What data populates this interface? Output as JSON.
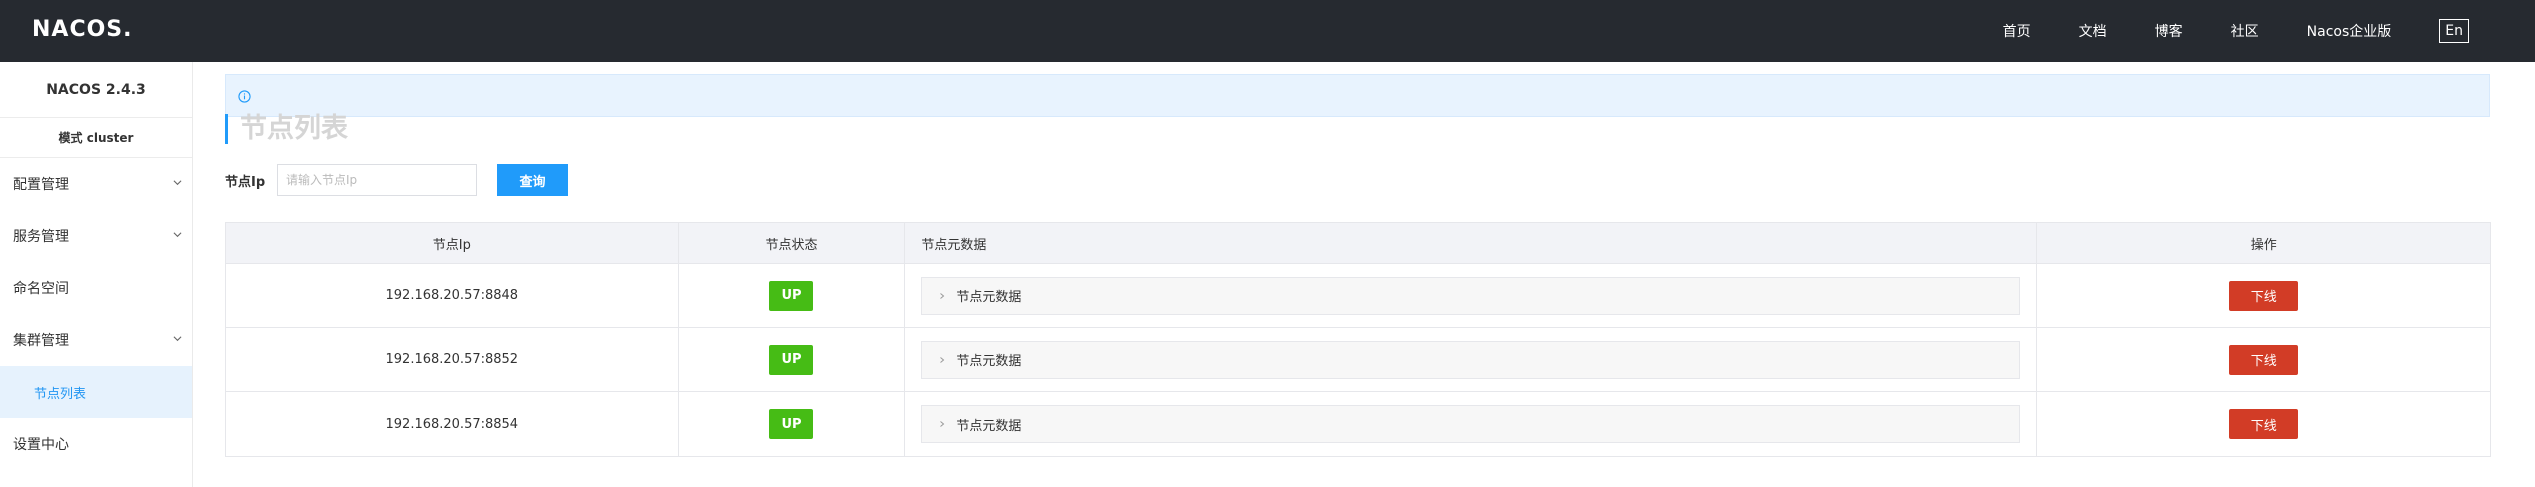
{
  "header": {
    "logo": "NACOS.",
    "nav": [
      {
        "label": "首页"
      },
      {
        "label": "文档"
      },
      {
        "label": "博客"
      },
      {
        "label": "社区"
      },
      {
        "label": "Nacos企业版"
      }
    ],
    "lang": "En"
  },
  "sidebar": {
    "version": "NACOS 2.4.3",
    "mode": "模式 cluster",
    "items": [
      {
        "label": "配置管理"
      },
      {
        "label": "服务管理"
      },
      {
        "label": "命名空间"
      },
      {
        "label": "集群管理"
      },
      {
        "label": "节点列表"
      },
      {
        "label": "设置中心"
      }
    ]
  },
  "main": {
    "title": "节点列表",
    "search": {
      "label": "节点Ip",
      "placeholder": "请输入节点Ip",
      "value": "",
      "button": "查询"
    },
    "table": {
      "headers": [
        "节点Ip",
        "节点状态",
        "节点元数据",
        "操作"
      ],
      "rows": [
        {
          "ip": "192.168.20.57:8848",
          "status": "UP",
          "meta": "节点元数据",
          "action": "下线"
        },
        {
          "ip": "192.168.20.57:8852",
          "status": "UP",
          "meta": "节点元数据",
          "action": "下线"
        },
        {
          "ip": "192.168.20.57:8854",
          "status": "UP",
          "meta": "节点元数据",
          "action": "下线"
        }
      ]
    }
  },
  "colors": {
    "header_bg": "#262a30",
    "primary": "#209bfa",
    "status_up": "#46bc15",
    "danger": "#d23c26"
  }
}
